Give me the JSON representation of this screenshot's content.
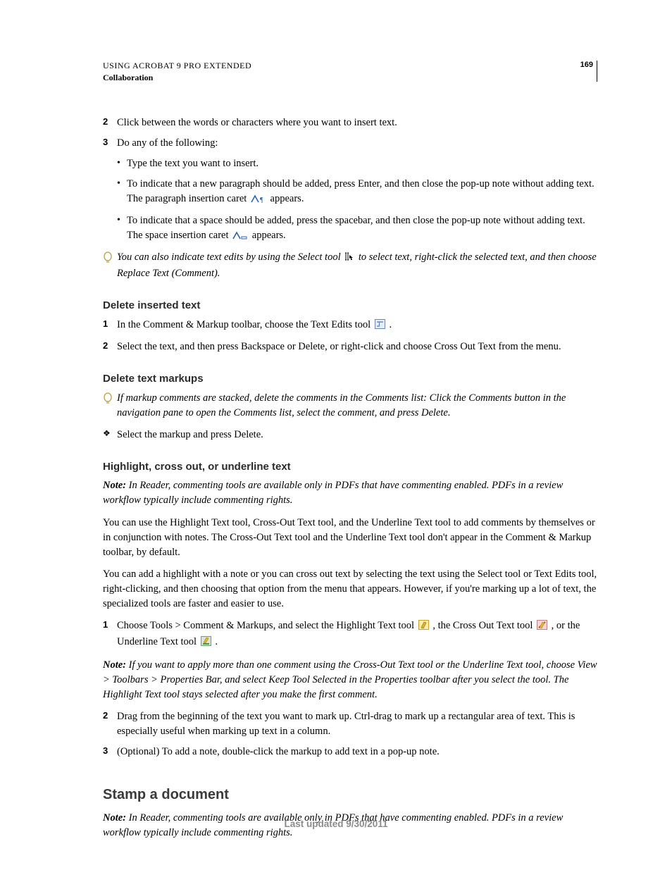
{
  "header": {
    "title": "USING ACROBAT 9 PRO EXTENDED",
    "subtitle": "Collaboration",
    "page_number": "169"
  },
  "top": {
    "step2": "Click between the words or characters where you want to insert text.",
    "step3": "Do any of the following:",
    "bullets": {
      "b1": "Type the text you want to insert.",
      "b2a": "To indicate that a new paragraph should be added, press Enter, and then close the pop-up note without adding text. The paragraph insertion caret ",
      "b2b": " appears.",
      "b3a": "To indicate that a space should be added, press the spacebar, and then close the pop-up note without adding text. The space insertion caret ",
      "b3b": " appears."
    },
    "tip_a": "You can also indicate text edits by using the Select tool ",
    "tip_b": " to select text, right-click the selected text, and then choose Replace Text (Comment)."
  },
  "delete_inserted": {
    "heading": "Delete inserted text",
    "s1a": "In the Comment & Markup toolbar, choose the Text Edits tool ",
    "s1b": ".",
    "s2": "Select the text, and then press Backspace or Delete, or right-click and choose Cross Out Text from the menu."
  },
  "delete_markups": {
    "heading": "Delete text markups",
    "tip": "If markup comments are stacked, delete the comments in the Comments list: Click the Comments button in the navigation pane to open the Comments list, select the comment, and press Delete.",
    "d1": "Select the markup and press Delete."
  },
  "highlight": {
    "heading": "Highlight, cross out, or underline text",
    "note_lead": "Note: ",
    "note": "In Reader, commenting tools are available only in PDFs that have commenting enabled. PDFs in a review workflow typically include commenting rights.",
    "p1": "You can use the Highlight Text tool, Cross-Out Text tool, and the Underline Text tool to add comments by themselves or in conjunction with notes. The Cross-Out Text tool and the Underline Text tool don't appear in the Comment & Markup toolbar, by default.",
    "p2": "You can add a highlight with a note or you can cross out text by selecting the text using the Select tool or Text Edits tool, right-clicking, and then choosing that option from the menu that appears. However, if you're marking up a lot of text, the specialized tools are faster and easier to use.",
    "s1a": "Choose Tools > Comment & Markups, and select the Highlight Text tool ",
    "s1b": ", the Cross Out Text tool ",
    "s1c": ", or the Underline Text tool ",
    "s1d": ".",
    "note2": "If you want to apply more than one comment using the Cross-Out Text tool or the Underline Text tool, choose View > Toolbars > Properties Bar, and select Keep Tool Selected in the Properties toolbar after you select the tool. The Highlight Text tool stays selected after you make the first comment.",
    "s2": "Drag from the beginning of the text you want to mark up. Ctrl-drag to mark up a rectangular area of text. This is especially useful when marking up text in a column.",
    "s3": "(Optional) To add a note, double-click the markup to add text in a pop-up note."
  },
  "stamp": {
    "heading": "Stamp a document",
    "note": "In Reader, commenting tools are available only in PDFs that have commenting enabled. PDFs in a review workflow typically include commenting rights."
  },
  "footer": "Last updated 9/30/2011"
}
